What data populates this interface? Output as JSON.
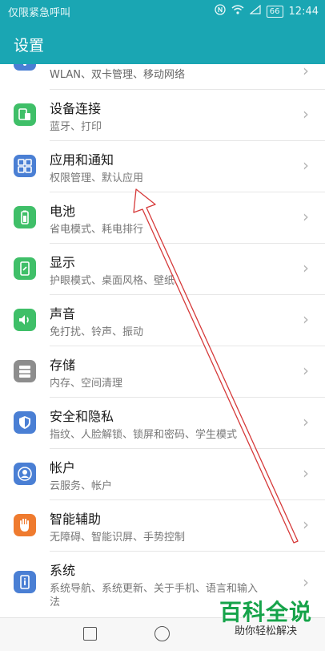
{
  "status": {
    "carrier": "仅限紧急呼叫",
    "battery": "66",
    "time": "12:44"
  },
  "header": {
    "title": "设置"
  },
  "items": [
    {
      "label": "",
      "sub": "WLAN、双卡管理、移动网络",
      "icon": "network-icon",
      "color": "#4a7fd4"
    },
    {
      "label": "设备连接",
      "sub": "蓝牙、打印",
      "icon": "device-connection-icon",
      "color": "#3fbf68"
    },
    {
      "label": "应用和通知",
      "sub": "权限管理、默认应用",
      "icon": "apps-icon",
      "color": "#4a7fd4"
    },
    {
      "label": "电池",
      "sub": "省电模式、耗电排行",
      "icon": "battery-icon",
      "color": "#3fbf68"
    },
    {
      "label": "显示",
      "sub": "护眼模式、桌面风格、壁纸",
      "icon": "display-icon",
      "color": "#3fbf68"
    },
    {
      "label": "声音",
      "sub": "免打扰、铃声、振动",
      "icon": "sound-icon",
      "color": "#3fbf68"
    },
    {
      "label": "存储",
      "sub": "内存、空间清理",
      "icon": "storage-icon",
      "color": "#8d8d8d"
    },
    {
      "label": "安全和隐私",
      "sub": "指纹、人脸解锁、锁屏和密码、学生模式",
      "icon": "shield-icon",
      "color": "#4a7fd4"
    },
    {
      "label": "帐户",
      "sub": "云服务、帐户",
      "icon": "account-icon",
      "color": "#4a7fd4"
    },
    {
      "label": "智能辅助",
      "sub": "无障碍、智能识屏、手势控制",
      "icon": "hand-icon",
      "color": "#ef7b2f"
    },
    {
      "label": "系统",
      "sub": "系统导航、系统更新、关于手机、语言和输入",
      "sub2": "法",
      "icon": "system-info-icon",
      "color": "#4a7fd4"
    }
  ],
  "watermark": {
    "big": "百科全说",
    "small": "助你轻松解决"
  }
}
